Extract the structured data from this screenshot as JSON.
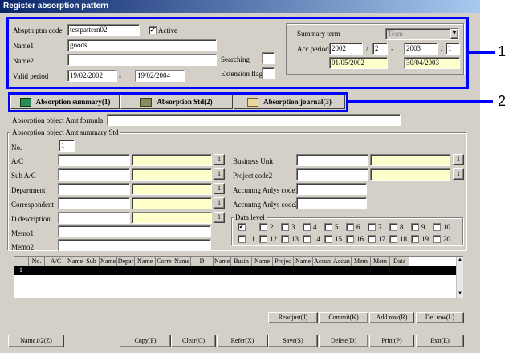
{
  "window": {
    "title": "Register absorption pattern"
  },
  "header": {
    "pattern_code_label": "Absptn ptm code",
    "pattern_code_value": "testpattern02",
    "active_label": "Active",
    "active_checked": true,
    "name1_label": "Name1",
    "name1_value": "goods",
    "name2_label": "Name2",
    "name2_value": "",
    "valid_period_label": "Valid period",
    "valid_from": "19/02/2002",
    "valid_sep": "-",
    "valid_to": "19/02/2004",
    "searching_label": "Searching",
    "extension_flag_label": "Extension flag"
  },
  "summary_term": {
    "label": "Summary term",
    "select_value": "Term",
    "acc_period_label": "Acc period",
    "from_year": "2002",
    "from_month": "2",
    "to_year": "2003",
    "to_month": "1",
    "slash": "/",
    "dash": "-",
    "from_date": "01/05/2002",
    "to_date": "30/04/2003"
  },
  "callouts": {
    "one": "1",
    "two": "2"
  },
  "tabs": [
    {
      "label": "Absorption summary(1)",
      "icon": "book-icon"
    },
    {
      "label": "Absorption Std(2)",
      "icon": "ledger-icon"
    },
    {
      "label": "Absorption journal(3)",
      "icon": "journal-icon"
    }
  ],
  "formula": {
    "label": "Absorption object Amt formula",
    "value": ""
  },
  "summary_std": {
    "group_label": "Absorption object Amt summary Std",
    "no_label": "No.",
    "no_value": "1",
    "left_rows": [
      "A/C",
      "Sub A/C",
      "Department",
      "Correspondent",
      "D description"
    ],
    "memo1_label": "Memo1",
    "memo2_label": "Memo2",
    "right_rows": [
      "Business Unit",
      "Project code2",
      "Accuntng Anlys code1",
      "Accuntng Anlys code2"
    ],
    "lookup_label": "1"
  },
  "data_level": {
    "label": "Data level",
    "checked": [
      1
    ],
    "levels": [
      "1",
      "2",
      "3",
      "4",
      "5",
      "6",
      "7",
      "8",
      "9",
      "10",
      "11",
      "12",
      "13",
      "14",
      "15",
      "16",
      "17",
      "18",
      "19",
      "20"
    ]
  },
  "grid": {
    "columns": [
      "No.",
      "A/C",
      "Name",
      "Sub",
      "Name",
      "Depar",
      "Name",
      "Corre",
      "Name",
      "D",
      "Name",
      "Busin",
      "Name",
      "Projec",
      "Name",
      "Accun",
      "Accun",
      "Mem",
      "Mem",
      "Data"
    ],
    "rows": [
      [
        "1"
      ]
    ]
  },
  "grid_buttons": {
    "readjust": "Readjust(J)",
    "commit": "Commit(K)",
    "add_row": "Add row(R)",
    "del_row": "Del row(L)"
  },
  "footer": {
    "name12": "Name1/2(Z)",
    "copy": "Copy(F)",
    "clear": "Clear(C)",
    "refer": "Refer(X)",
    "save": "Save(S)",
    "delete": "Delete(D)",
    "print": "Print(P)",
    "exit": "Exit(E)"
  },
  "colors": {
    "title_bar": "#0a246a",
    "callout": "#0000ff",
    "yellow_field": "#ffffcc",
    "face": "#d4d0c8"
  }
}
